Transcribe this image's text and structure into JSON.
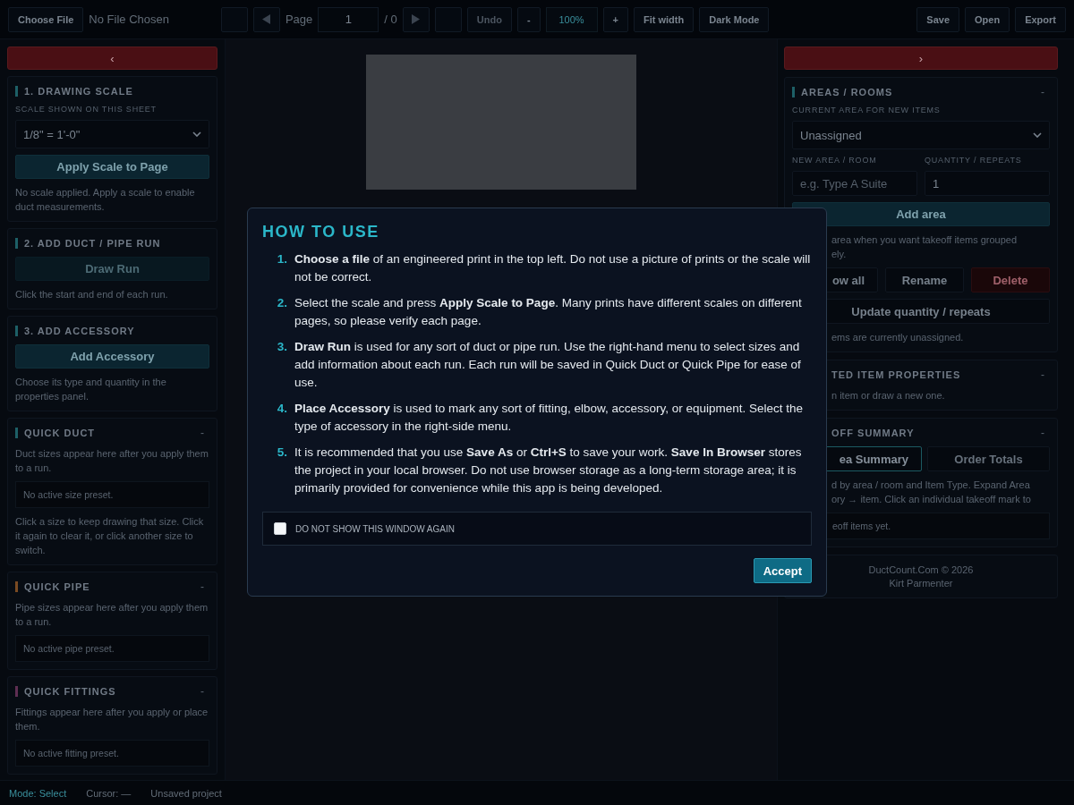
{
  "toolbar": {
    "left": [
      {
        "kind": "button",
        "label": "Choose File",
        "disabled": false
      },
      {
        "kind": "text",
        "text": "No File Chosen"
      }
    ],
    "center": [
      {
        "kind": "blank"
      },
      {
        "kind": "prev"
      },
      {
        "kind": "text",
        "text": "Page"
      },
      {
        "kind": "input",
        "value": "1"
      },
      {
        "kind": "text",
        "text": "/ 0"
      },
      {
        "kind": "next"
      },
      {
        "kind": "blank"
      },
      {
        "kind": "button",
        "label": "Undo",
        "disabled": true
      },
      {
        "kind": "button",
        "label": "-",
        "disabled": false
      },
      {
        "kind": "zoom",
        "text": "100%"
      },
      {
        "kind": "button",
        "label": "+",
        "disabled": false
      },
      {
        "kind": "button",
        "label": "Fit width",
        "disabled": false
      },
      {
        "kind": "button",
        "label": "Dark Mode",
        "disabled": false
      }
    ],
    "right": [
      {
        "kind": "button",
        "label": "Save",
        "disabled": false
      },
      {
        "kind": "button",
        "label": "Open",
        "disabled": false
      },
      {
        "kind": "button",
        "label": "Export",
        "disabled": false
      }
    ]
  },
  "left_panel": {
    "collapse_button": "‹",
    "sections": [
      {
        "title": "1. DRAWING SCALE",
        "color": "#1d5f66",
        "blocks": [
          {
            "kind": "label",
            "text": "SCALE SHOWN ON THIS SHEET"
          },
          {
            "kind": "select",
            "value": "1/8\" = 1'-0\""
          },
          {
            "kind": "button",
            "label": "Apply Scale to Page",
            "disabled": false
          },
          {
            "kind": "note",
            "text": "No scale applied. Apply a scale to enable duct measurements."
          }
        ]
      },
      {
        "title": "2. ADD DUCT / PIPE RUN",
        "color": "#1d5f66",
        "blocks": [
          {
            "kind": "button",
            "label": "Draw Run",
            "disabled": true
          },
          {
            "kind": "note",
            "text": "Click the start and end of each run."
          }
        ]
      },
      {
        "title": "3. ADD ACCESSORY",
        "color": "#1d5f66",
        "blocks": [
          {
            "kind": "button",
            "label": "Add Accessory",
            "disabled": false
          },
          {
            "kind": "note",
            "text": "Choose its type and quantity in the properties panel."
          }
        ]
      },
      {
        "title": "QUICK DUCT",
        "color": "#1d5f66",
        "toggle": "-",
        "blocks": [
          {
            "kind": "note",
            "text": "Duct sizes appear here after you apply them to a run."
          },
          {
            "kind": "preset",
            "text": "No active size preset."
          },
          {
            "kind": "note",
            "text": "Click a size to keep drawing that size. Click it again to clear it, or click another size to switch."
          }
        ]
      },
      {
        "title": "QUICK PIPE",
        "color": "#7a4a22",
        "toggle": "-",
        "blocks": [
          {
            "kind": "note",
            "text": "Pipe sizes appear here after you apply them to a run."
          },
          {
            "kind": "preset",
            "text": "No active pipe preset."
          }
        ]
      },
      {
        "title": "QUICK FITTINGS",
        "color": "#5e2e52",
        "toggle": "-",
        "blocks": [
          {
            "kind": "note",
            "text": "Fittings appear here after you apply or place them."
          },
          {
            "kind": "preset",
            "text": "No active fitting preset."
          }
        ]
      }
    ]
  },
  "right_panel": {
    "collapse_button": "›",
    "sections": [
      {
        "title": "AREAS / ROOMS",
        "color": "#1d5f66",
        "toggle": "-",
        "blocks": [
          {
            "kind": "label",
            "text": "CURRENT AREA FOR NEW ITEMS"
          },
          {
            "kind": "select",
            "value": "Unassigned"
          },
          {
            "kind": "label-row",
            "labels": [
              "NEW AREA / ROOM",
              "QUANTITY / REPEATS"
            ]
          },
          {
            "kind": "input-row",
            "inputs": [
              {
                "placeholder": "e.g. Type A Suite"
              },
              {
                "value": "1"
              }
            ]
          },
          {
            "kind": "button",
            "label": "Add area",
            "disabled": false
          },
          {
            "kind": "cut-note",
            "lines": [
              "area when you want takeoff items grouped",
              "ely."
            ]
          },
          {
            "kind": "button-row",
            "buttons": [
              {
                "label": "ow all",
                "danger": false
              },
              {
                "label": "Rename",
                "danger": false
              },
              {
                "label": "Delete",
                "danger": true
              }
            ]
          },
          {
            "kind": "plain-button",
            "label": "Update quantity / repeats"
          },
          {
            "kind": "cut-note",
            "lines": [
              "ems are currently unassigned."
            ]
          }
        ]
      },
      {
        "title": "TED ITEM PROPERTIES",
        "toggle": "-",
        "blocks": [
          {
            "kind": "cut-note",
            "lines": [
              "n item or draw a new one."
            ]
          }
        ]
      },
      {
        "title": "OFF SUMMARY",
        "toggle": "-",
        "blocks": [
          {
            "kind": "tabs",
            "tabs": [
              {
                "label": "ea Summary",
                "selected": true
              },
              {
                "label": "Order Totals",
                "selected": false
              }
            ]
          },
          {
            "kind": "cut-note",
            "lines": [
              "d by area / room and Item Type. Expand Area",
              "ory → item. Click an individual takeoff mark to"
            ]
          },
          {
            "kind": "cut-preset",
            "text": "eoff items yet."
          }
        ]
      }
    ],
    "footer": [
      "DuctCount.Com © 2026",
      "Kirt Parmenter"
    ]
  },
  "status_bar": {
    "mode": "Mode: Select",
    "cursor": "Cursor: —",
    "project": "Unsaved project"
  },
  "modal": {
    "title": "HOW TO USE",
    "steps": [
      {
        "number": "1.",
        "text": "**Choose a file** of an engineered print in the top left. Do not use a picture of prints or the scale will not be correct."
      },
      {
        "number": "2.",
        "text": "Select the scale and press **Apply Scale to Page**. Many prints have different scales on different pages, so please verify each page."
      },
      {
        "number": "3.",
        "text": "**Draw Run** is used for any sort of duct or pipe run. Use the right-hand menu to select sizes and add information about each run. Each run will be saved in Quick Duct or Quick Pipe for ease of use."
      },
      {
        "number": "4.",
        "text": "**Place Accessory** is used to mark any sort of fitting, elbow, accessory, or equipment. Select the type of accessory in the right-side menu."
      },
      {
        "number": "5.",
        "text": "It is recommended that you use **Save As** or **Ctrl+S** to save your work. **Save In Browser** stores the project in your local browser. Do not use browser storage as a long-term storage area; it is primarily provided for convenience while this app is being developed."
      }
    ],
    "dont_show": {
      "label": "DO NOT SHOW THIS WINDOW AGAIN",
      "checked": false
    },
    "accept": "Accept"
  }
}
